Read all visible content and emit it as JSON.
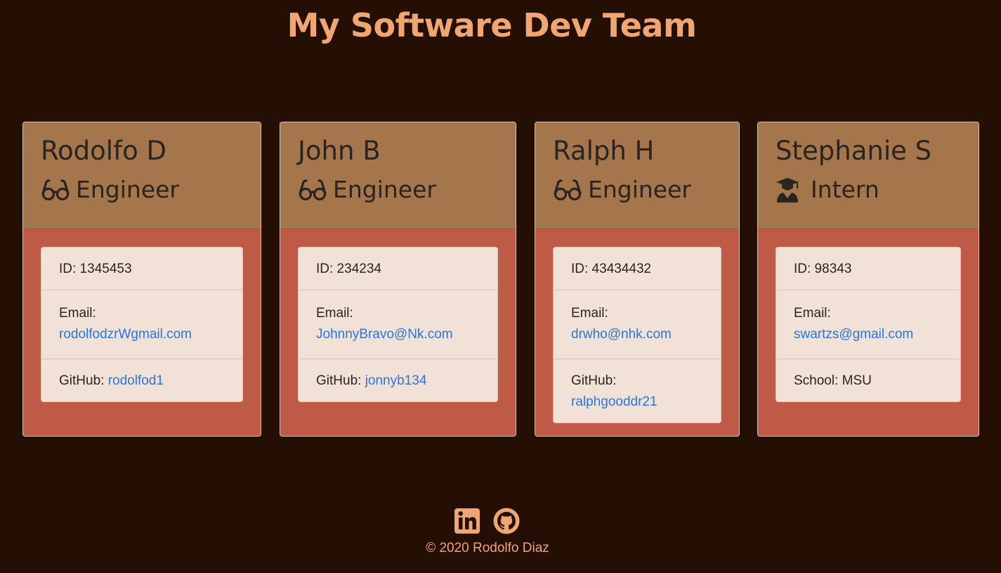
{
  "page": {
    "title": "My Software Dev Team"
  },
  "team": [
    {
      "name": "Rodolfo D",
      "role": "Engineer",
      "role_icon": "glasses-icon",
      "id_text": "ID: 1345453",
      "email_label": "Email:",
      "email": "rodolfodzrWgmail.com",
      "extra_label": "GitHub:",
      "extra_value": "rodolfod1",
      "extra_is_link": true
    },
    {
      "name": "John B",
      "role": "Engineer",
      "role_icon": "glasses-icon",
      "id_text": "ID: 234234",
      "email_label": "Email:",
      "email": "JohnnyBravo@Nk.com",
      "extra_label": "GitHub:",
      "extra_value": "jonnyb134",
      "extra_is_link": true
    },
    {
      "name": "Ralph H",
      "role": "Engineer",
      "role_icon": "glasses-icon",
      "id_text": "ID: 43434432",
      "email_label": "Email:",
      "email": "drwho@nhk.com",
      "extra_label": "GitHub:",
      "extra_value": "ralphgooddr21",
      "extra_is_link": true
    },
    {
      "name": "Stephanie S",
      "role": "Intern",
      "role_icon": "graduate-icon",
      "id_text": "ID: 98343",
      "email_label": "Email:",
      "email": "swartzs@gmail.com",
      "extra_label": "School:",
      "extra_value": "MSU",
      "extra_is_link": false
    }
  ],
  "footer": {
    "icons": [
      "linkedin-icon",
      "github-icon"
    ],
    "copyright": "© 2020 Rodolfo Diaz"
  },
  "colors": {
    "background": "#250e03",
    "accent": "#f0a670",
    "card_header": "#a5764c",
    "card_body": "#be5a45",
    "list_bg": "#f2e1d6",
    "link": "#2777df"
  }
}
